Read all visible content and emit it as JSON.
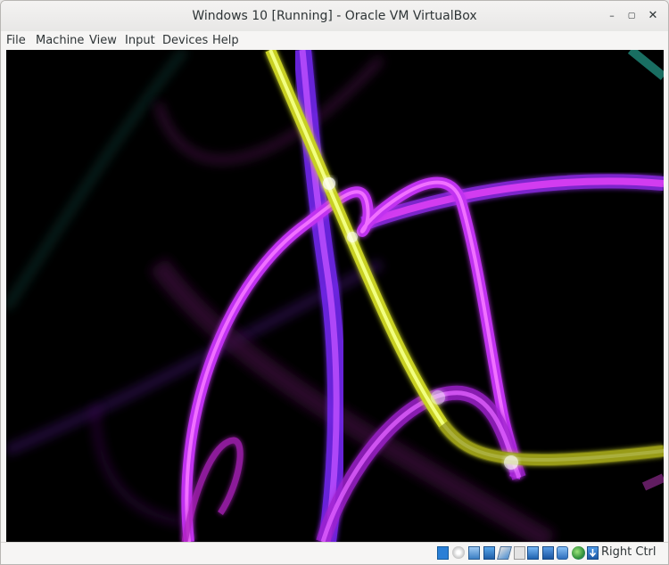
{
  "window": {
    "title": "Windows 10 [Running] - Oracle VM VirtualBox",
    "controls": {
      "minimize": "–",
      "maximize": "▢",
      "close": "✕"
    }
  },
  "menu": {
    "items": [
      "File",
      "Machine",
      "View",
      "Input",
      "Devices",
      "Help"
    ]
  },
  "guest_display": {
    "background": "#000000",
    "colors": {
      "magenta": "#d23cf0",
      "violet": "#8a2be2",
      "yellow": "#dfe83a",
      "teal": "#1f6a60"
    }
  },
  "statusbar": {
    "icons": [
      "hard-disk-icon",
      "optical-drive-icon",
      "audio-icon",
      "network-icon",
      "usb-icon",
      "shared-folders-icon",
      "display-icon",
      "video-capture-icon",
      "cpu-icon",
      "mouse-integration-icon",
      "keyboard-capture-icon"
    ],
    "host_key": "Right Ctrl"
  }
}
